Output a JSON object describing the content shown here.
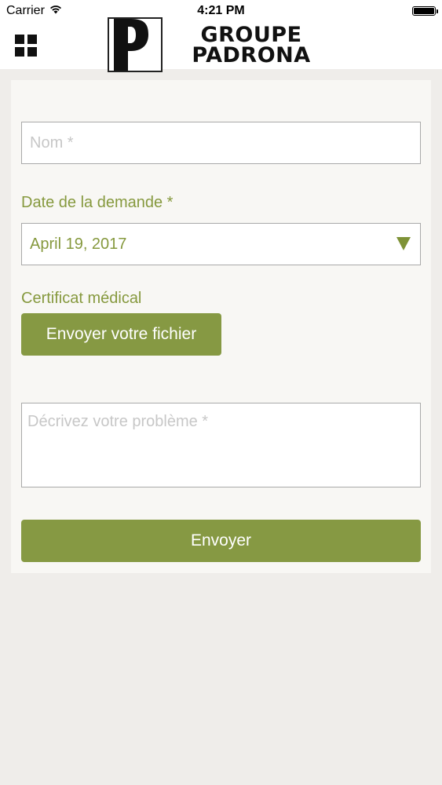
{
  "status_bar": {
    "carrier": "Carrier",
    "time": "4:21 PM",
    "battery_level": 1.0
  },
  "header": {
    "menu_icon": "grid-menu-icon",
    "logo_letter": "P",
    "logo_line1": "GROUPE",
    "logo_line2": "PADRONA"
  },
  "form": {
    "nom_placeholder": "Nom *",
    "date_label": "Date de la demande *",
    "date_value": "April 19, 2017",
    "certificat_label": "Certificat médical",
    "file_button_label": "Envoyer votre fichier",
    "problem_placeholder": "Décrivez votre problème *",
    "submit_label": "Envoyer"
  },
  "colors": {
    "accent": "#869943",
    "label_text": "#86993e",
    "background": "#efedea",
    "card": "#f8f7f4"
  }
}
